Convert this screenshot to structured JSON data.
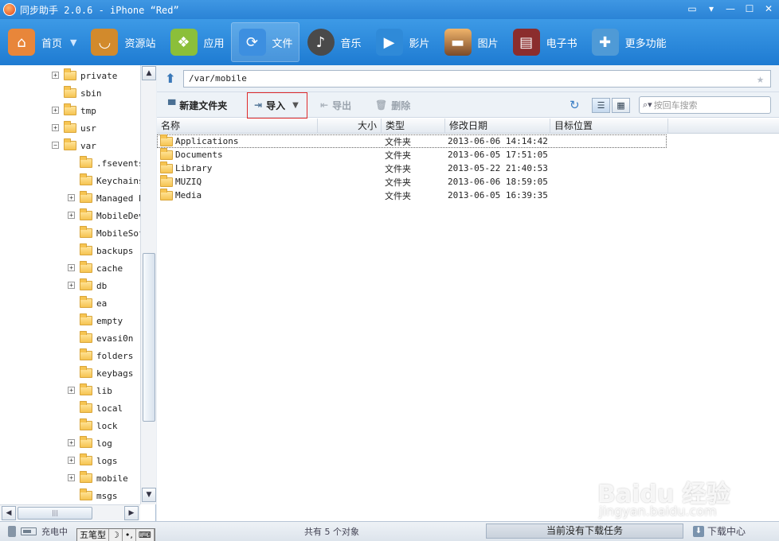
{
  "window": {
    "title": "同步助手 2.0.6 - iPhone “Red”"
  },
  "toolbar": {
    "items": [
      {
        "label": "首页",
        "icon": "home-icon",
        "color": "#e8863a"
      },
      {
        "label": "资源站",
        "icon": "shopping-bag-icon",
        "color": "#d28a2c"
      },
      {
        "label": "应用",
        "icon": "apps-icon",
        "color": "#8bbf3a"
      },
      {
        "label": "文件",
        "icon": "folder-sync-icon",
        "color": "#3d8fe0"
      },
      {
        "label": "音乐",
        "icon": "music-note-icon",
        "color": "#4a4a4a"
      },
      {
        "label": "影片",
        "icon": "play-icon",
        "color": "#2f8ad8"
      },
      {
        "label": "图片",
        "icon": "picture-icon",
        "color": "#c9753a"
      },
      {
        "label": "电子书",
        "icon": "book-icon",
        "color": "#8b2d2d"
      },
      {
        "label": "更多功能",
        "icon": "tools-icon",
        "color": "#4f9ad6"
      }
    ]
  },
  "tree": {
    "items": [
      {
        "label": "private",
        "expandable": true,
        "level": 0
      },
      {
        "label": "sbin",
        "expandable": false,
        "level": 0
      },
      {
        "label": "tmp",
        "expandable": true,
        "level": 0
      },
      {
        "label": "usr",
        "expandable": true,
        "level": 0
      },
      {
        "label": "var",
        "expandable": true,
        "expanded": true,
        "level": 0
      },
      {
        "label": ".fsevents",
        "expandable": false,
        "level": 1
      },
      {
        "label": "Keychains",
        "expandable": false,
        "level": 1
      },
      {
        "label": "Managed P",
        "expandable": true,
        "level": 1
      },
      {
        "label": "MobileDev",
        "expandable": true,
        "level": 1
      },
      {
        "label": "MobileSof",
        "expandable": false,
        "level": 1
      },
      {
        "label": "backups",
        "expandable": false,
        "level": 1
      },
      {
        "label": "cache",
        "expandable": true,
        "level": 1
      },
      {
        "label": "db",
        "expandable": true,
        "level": 1
      },
      {
        "label": "ea",
        "expandable": false,
        "level": 1
      },
      {
        "label": "empty",
        "expandable": false,
        "level": 1
      },
      {
        "label": "evasi0n",
        "expandable": false,
        "level": 1
      },
      {
        "label": "folders",
        "expandable": false,
        "level": 1
      },
      {
        "label": "keybags",
        "expandable": false,
        "level": 1
      },
      {
        "label": "lib",
        "expandable": true,
        "level": 1
      },
      {
        "label": "local",
        "expandable": false,
        "level": 1
      },
      {
        "label": "lock",
        "expandable": false,
        "level": 1
      },
      {
        "label": "log",
        "expandable": true,
        "level": 1
      },
      {
        "label": "logs",
        "expandable": true,
        "level": 1
      },
      {
        "label": "mobile",
        "expandable": true,
        "level": 1
      },
      {
        "label": "msgs",
        "expandable": false,
        "level": 1
      }
    ]
  },
  "path": {
    "value": "/var/mobile"
  },
  "actions": {
    "new_folder": "新建文件夹",
    "import": "导入",
    "export": "导出",
    "delete": "删除"
  },
  "search": {
    "placeholder": "按回车搜索"
  },
  "columns": {
    "name": "名称",
    "size": "大小",
    "type": "类型",
    "date": "修改日期",
    "target": "目标位置"
  },
  "files": [
    {
      "name": "Applications",
      "type": "文件夹",
      "date": "2013-06-06 14:14:42",
      "selected": true
    },
    {
      "name": "Documents",
      "type": "文件夹",
      "date": "2013-06-05 17:51:05"
    },
    {
      "name": "Library",
      "type": "文件夹",
      "date": "2013-05-22 21:40:53"
    },
    {
      "name": "MUZIQ",
      "type": "文件夹",
      "date": "2013-06-06 18:59:05"
    },
    {
      "name": "Media",
      "type": "文件夹",
      "date": "2013-06-05 16:39:35"
    }
  ],
  "status": {
    "charging": "充电中",
    "object_count": "共有 5 个对象",
    "download_task": "当前没有下载任务",
    "download_center": "下载中心",
    "ime": [
      "五笔型",
      "☽",
      "•,",
      "⌨"
    ]
  },
  "watermark": {
    "brand": "Baidu 经验",
    "url": "jingyan.baidu.com"
  }
}
